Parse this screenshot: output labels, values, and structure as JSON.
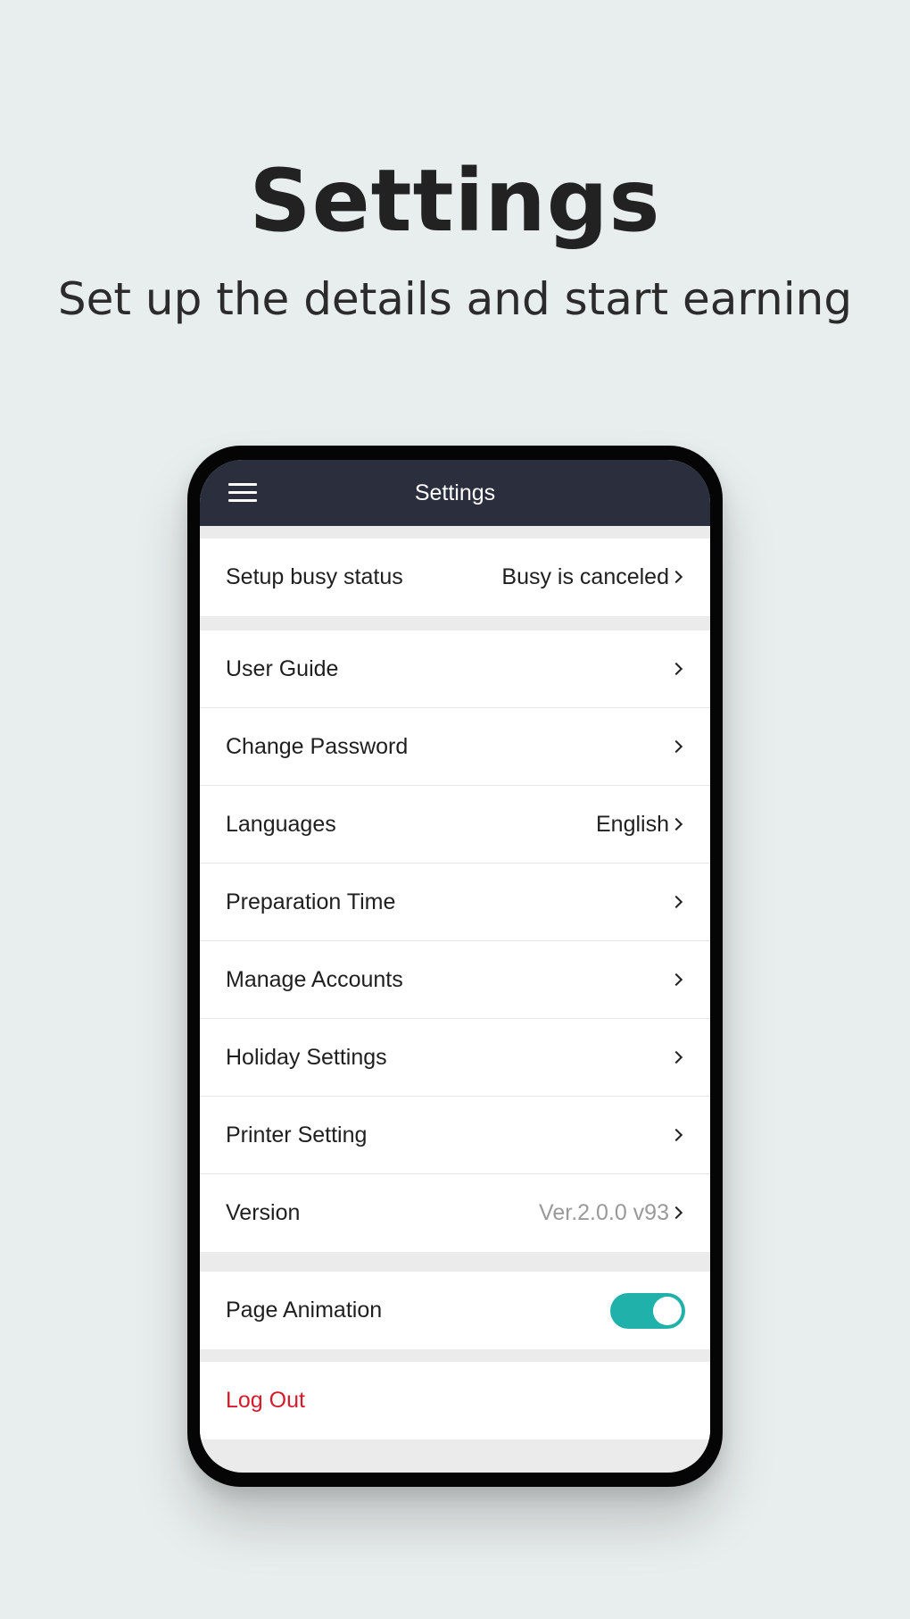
{
  "hero": {
    "title": "Settings",
    "subtitle": "Set up the details and start earning"
  },
  "app_bar": {
    "title": "Settings",
    "menu_icon": "hamburger-menu-icon"
  },
  "busy_section": {
    "label": "Setup busy status",
    "value": "Busy is canceled"
  },
  "menu_items": [
    {
      "label": "User Guide",
      "value": ""
    },
    {
      "label": "Change Password",
      "value": ""
    },
    {
      "label": "Languages",
      "value": "English"
    },
    {
      "label": "Preparation Time",
      "value": ""
    },
    {
      "label": "Manage Accounts",
      "value": ""
    },
    {
      "label": "Holiday Settings",
      "value": ""
    },
    {
      "label": "Printer Setting",
      "value": ""
    },
    {
      "label": "Version",
      "value": "Ver.2.0.0 v93"
    }
  ],
  "page_animation": {
    "label": "Page Animation",
    "enabled": true
  },
  "logout": {
    "label": "Log Out"
  },
  "colors": {
    "background": "#e8eeed",
    "app_bar": "#2b2f3d",
    "toggle_on": "#20b2aa",
    "logout": "#d7192b",
    "muted_value": "#9a9a9a"
  }
}
